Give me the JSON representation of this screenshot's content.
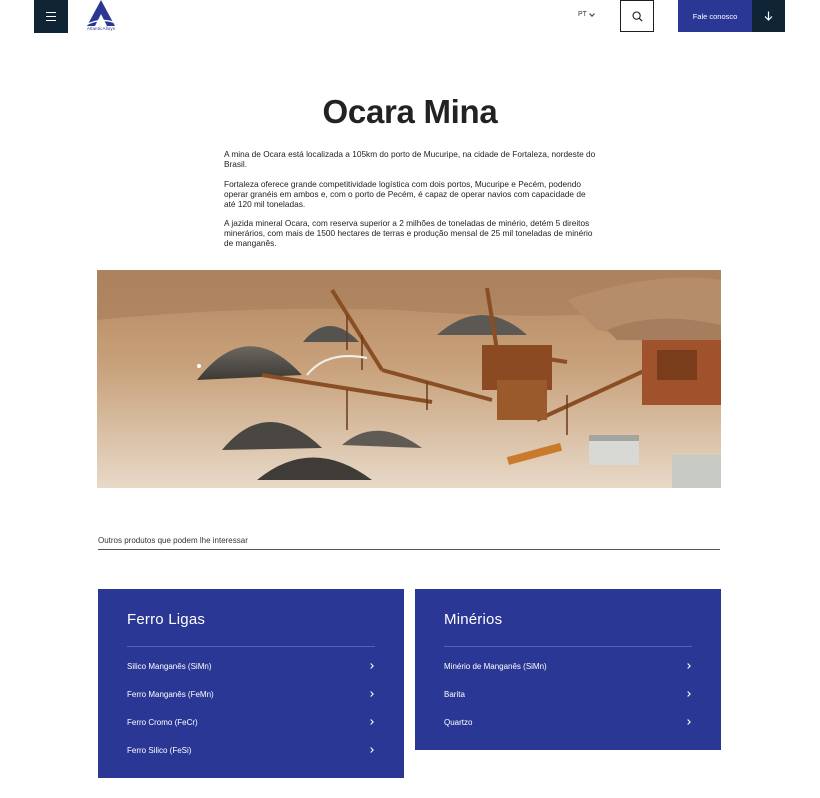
{
  "header": {
    "logo_text": "AtlanticAlloys",
    "language": "PT",
    "contact_label": "Fale conosco"
  },
  "page": {
    "title": "Ocara Mina",
    "paragraphs": [
      "A mina de Ocara está localizada a 105km do porto de Mucuripe, na cidade de Fortaleza, nordeste do Brasil.",
      "Fortaleza oferece grande competitividade logística com dois portos, Mucuripe e Pecém, podendo operar granéis em ambos e, com o porto de Pecém, é capaz de operar navios com capacidade de até 120 mil toneladas.",
      "A jazida mineral Ocara, com reserva superior a 2 milhões de toneladas de minério, detém 5 direitos minerários, com mais de 1500 hectares de terras e produção mensal de 25 mil toneladas de minério de manganês."
    ]
  },
  "related": {
    "label": "Outros produtos que podem lhe interessar",
    "cards": [
      {
        "title": "Ferro Ligas",
        "items": [
          "Silico Manganês (SiMn)",
          "Ferro Manganês (FeMn)",
          "Ferro Cromo (FeCr)",
          "Ferro Silico (FeSi)"
        ]
      },
      {
        "title": "Minérios",
        "items": [
          "Minério de Manganês (SiMn)",
          "Barita",
          "Quartzo"
        ]
      }
    ]
  },
  "colors": {
    "brand_blue": "#2b3795",
    "dark_navy": "#0f2535"
  }
}
